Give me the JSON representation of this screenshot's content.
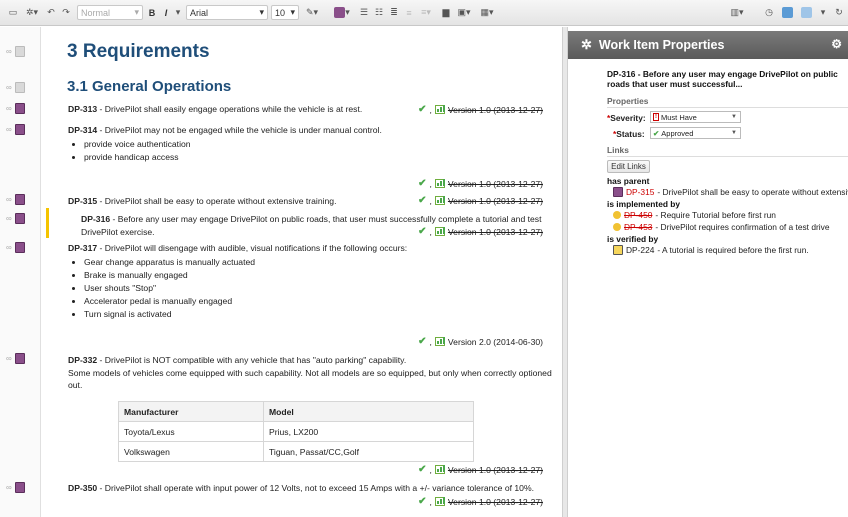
{
  "toolbar": {
    "style_select": "Normal",
    "font_select": "Arial",
    "size_select": "10",
    "bold": "B",
    "italic": "I"
  },
  "document": {
    "heading1": "3 Requirements",
    "heading2": "3.1 General Operations",
    "requirements": [
      {
        "id": "DP-313",
        "text": " - DrivePilot shall easily engage operations while the vehicle is at rest.",
        "version": "Version 1.0 (2013-12-27)"
      },
      {
        "id": "DP-314",
        "text": " - DrivePilot may not be engaged while the vehicle is under manual control.",
        "bullets": [
          "provide voice authentication",
          "provide handicap access"
        ],
        "version": "Version 1.0 (2013-12-27)"
      },
      {
        "id": "DP-315",
        "text": " - DrivePilot shall be easy to operate without extensive training.",
        "version": "Version 1.0 (2013-12-27)"
      },
      {
        "id": "DP-316",
        "text": " - Before any user may engage DrivePilot on public roads, that user must successfully complete a tutorial and test DrivePilot exercise.",
        "version": "Version 1.0 (2013-12-27)"
      },
      {
        "id": "DP-317",
        "text": " - DrivePilot will disengage with audible, visual notifications if the following occurs:",
        "bullets": [
          "Gear change apparatus is manually actuated",
          "Brake is manually engaged",
          "User shouts \"Stop\"",
          "Accelerator pedal is manually engaged",
          "Turn signal is activated"
        ],
        "version": "Version 2.0 (2014-06-30)"
      },
      {
        "id": "DP-332",
        "text": " - DrivePilot is NOT compatible with any vehicle that has \"auto parking\" capability.",
        "extra": "Some models of vehicles come equipped with such capability.  Not all models are so equipped, but only when correctly optioned out.",
        "version": "Version 1.0 (2013-12-27)"
      },
      {
        "id": "DP-350",
        "text": " - DrivePilot shall operate with input power of 12 Volts, not to exceed 15 Amps with a +/- variance tolerance of 10%.",
        "version": "Version 1.0 (2013-12-27)"
      }
    ],
    "table": {
      "headers": [
        "Manufacturer",
        "Model"
      ],
      "rows": [
        [
          "Toyota/Lexus",
          "Prius, LX200"
        ],
        [
          "Volkswagen",
          "Tiguan, Passat/CC,Golf"
        ]
      ]
    }
  },
  "panel": {
    "title": "Work Item Properties",
    "item_title": "DP-316 - Before any user may engage DrivePilot on public roads that user must successful...",
    "properties_label": "Properties",
    "severity_label": "Severity:",
    "severity_value": "Must Have",
    "status_label": "Status:",
    "status_value": "Approved",
    "links_label": "Links",
    "edit_links": "Edit Links",
    "has_parent": "has parent",
    "parent": {
      "id": "DP-315",
      "text": " - DrivePilot shall be easy to operate without extensive"
    },
    "is_implemented_by": "is implemented by",
    "implemented": [
      {
        "id": "DP-450",
        "text": " - Require Tutorial before first run"
      },
      {
        "id": "DP-453",
        "text": " - DrivePilot requires confirmation of a test drive"
      }
    ],
    "is_verified_by": "is verified by",
    "verified": {
      "id": "DP-224",
      "text": " - A tutorial  is required before the first run."
    }
  },
  "colors": {
    "heading": "#1f4e79",
    "link_red": "#cc0000",
    "approved_green": "#4aa74a",
    "edit_marker": "#f5c400"
  }
}
